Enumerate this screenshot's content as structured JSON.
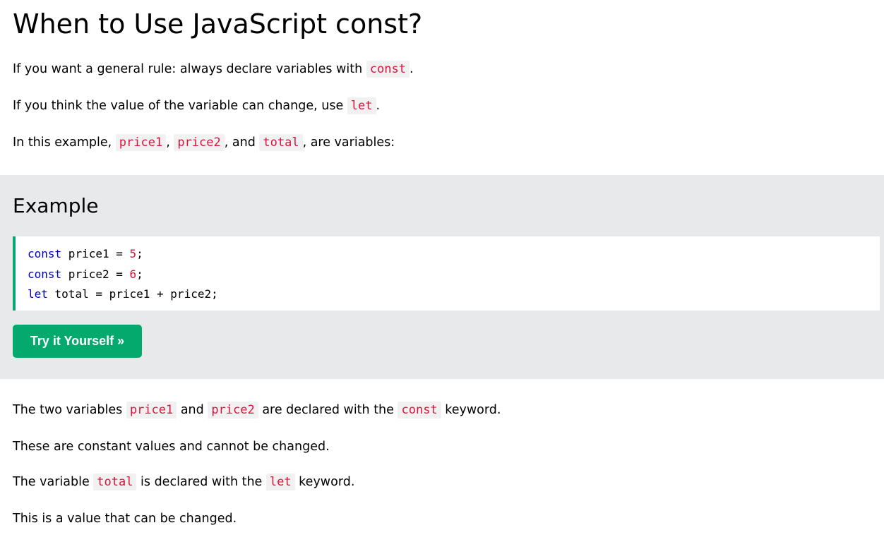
{
  "heading": "When to Use JavaScript const?",
  "intro": {
    "p1": {
      "text": "If you want a general rule: always declare variables with ",
      "code": "const",
      "end": "."
    },
    "p2": {
      "text": "If you think the value of the variable can change, use ",
      "code": "let",
      "end": "."
    },
    "p3": {
      "text": "In this example, ",
      "code1": "price1",
      "sep1": ", ",
      "code2": "price2",
      "sep2": ", and ",
      "code3": "total",
      "end": ", are variables:"
    }
  },
  "example": {
    "title": "Example",
    "code": {
      "line1": {
        "kw": "const",
        "rest": " price1 = ",
        "num": "5",
        "end": ";"
      },
      "line2": {
        "kw": "const",
        "rest": " price2 = ",
        "num": "6",
        "end": ";"
      },
      "line3": {
        "kw": "let",
        "rest": " total = price1 + price2;"
      }
    },
    "button_label": "Try it Yourself »"
  },
  "outro": {
    "p1": {
      "t1": "The two variables ",
      "code1": "price1",
      "t2": " and ",
      "code2": "price2",
      "t3": " are declared with the ",
      "code3": "const",
      "t4": " keyword."
    },
    "p2": "These are constant values and cannot be changed.",
    "p3": {
      "t1": "The variable ",
      "code1": "total",
      "t2": " is declared with the ",
      "code2": "let",
      "t3": " keyword."
    },
    "p4": "This is a value that can be changed."
  },
  "colors": {
    "accent_green": "#04aa6d",
    "code_red": "#dc143c",
    "keyword_blue": "#0000cd",
    "example_bg": "#e7e9eb"
  }
}
